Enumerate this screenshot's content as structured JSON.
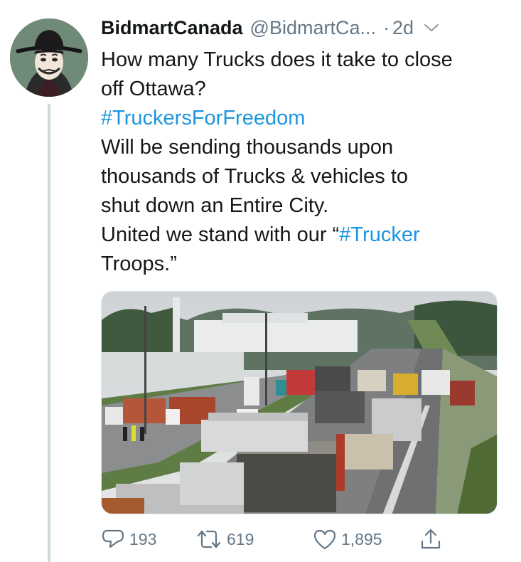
{
  "tweet": {
    "display_name": "BidmartCanada",
    "handle": "@BidmartCa...",
    "separator": "·",
    "time": "2d",
    "text": {
      "line1": "How many Trucks does it take to close",
      "line2": "off Ottawa?",
      "hashtag1": "#TruckersForFreedom",
      "line4": "Will be sending thousands upon",
      "line5": "thousands of Trucks & vehicles to",
      "line6": "shut down an Entire City.",
      "line7_prefix": "United we stand with our “",
      "hashtag2": "#Trucker",
      "line8": "Troops.”"
    }
  },
  "actions": {
    "replies": "193",
    "retweets": "619",
    "likes": "1,895"
  },
  "icons": {
    "caret": "chevron-down-icon",
    "reply": "reply-icon",
    "retweet": "retweet-icon",
    "like": "heart-icon",
    "share": "share-icon"
  },
  "colors": {
    "link": "#1b95e0",
    "secondary_text": "#657786",
    "thread_line": "#cfd9de"
  }
}
